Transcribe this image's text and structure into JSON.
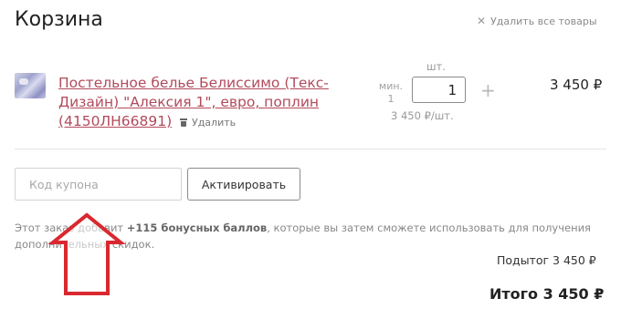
{
  "cart": {
    "title": "Корзина",
    "clear_all_label": "Удалить все товары",
    "clear_all_icon": "close-icon"
  },
  "item": {
    "name": "Постельное белье Белиссимо (Текс-Дизайн) \"Алексия 1\", евро, поплин (4150ЛН66891)",
    "remove_label": "Удалить",
    "quantity_unit": "шт.",
    "min_label": "мин. 1",
    "quantity": "1",
    "plus_symbol": "+",
    "unit_price": "3 450  ₽/шт.",
    "line_total": "3 450 ₽"
  },
  "coupon": {
    "placeholder": "Код купона",
    "value": "",
    "activate_label": "Активировать"
  },
  "bonus": {
    "prefix": "Этот заказ добавит ",
    "points": "+115 бонусных баллов",
    "suffix": ", которые вы затем сможете использовать для получения дополнительных скидок."
  },
  "summary": {
    "subtotal": "Подытог 3 450  ₽",
    "total": "Итого 3 450 ₽"
  },
  "colors": {
    "product_link": "#b24a5b",
    "annotation_arrow": "#d9282f"
  }
}
